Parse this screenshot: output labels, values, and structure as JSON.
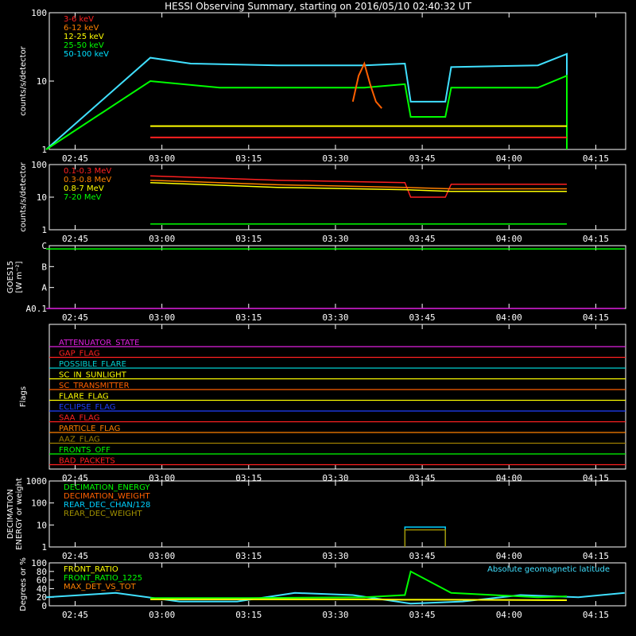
{
  "title": "HESSI Observing Summary, starting on 2016/05/10 02:40:32 UT",
  "time_labels": [
    "02:45",
    "03:00",
    "03:15",
    "03:30",
    "03:45",
    "04:00",
    "04:15"
  ],
  "chart_data": [
    {
      "type": "line",
      "name": "panel-1",
      "ylabel": "counts/s/detector",
      "yscale": "log",
      "ylim": [
        1,
        100
      ],
      "yticks": [
        "1",
        "10",
        "100"
      ],
      "legend": [
        {
          "label": "3-6 keV",
          "color": "#ff2020"
        },
        {
          "label": "6-12 keV",
          "color": "#ff8000"
        },
        {
          "label": "12-25 keV",
          "color": "#ffff00"
        },
        {
          "label": "25-50 keV",
          "color": "#00ff00"
        },
        {
          "label": "50-100 keV",
          "color": "#00e0ff"
        }
      ],
      "series": [
        {
          "name": "50-100 keV",
          "color": "#40e0ff",
          "x": [
            "02:40",
            "02:58",
            "03:05",
            "03:20",
            "03:35",
            "03:42",
            "03:43",
            "03:49",
            "03:50",
            "04:05",
            "04:10",
            "04:10"
          ],
          "y": [
            1,
            22,
            18,
            17,
            17,
            18,
            5,
            5,
            16,
            17,
            25,
            1
          ]
        },
        {
          "name": "25-50 keV",
          "color": "#00ff00",
          "x": [
            "02:40",
            "02:58",
            "03:10",
            "03:25",
            "03:35",
            "03:42",
            "03:43",
            "03:49",
            "03:50",
            "04:05",
            "04:10",
            "04:10"
          ],
          "y": [
            1,
            10,
            8,
            8,
            8,
            9,
            3,
            3,
            8,
            8,
            12,
            1
          ]
        },
        {
          "name": "6-12 keV",
          "color": "#ff6000",
          "x": [
            "03:33",
            "03:34",
            "03:35",
            "03:36",
            "03:37",
            "03:38"
          ],
          "y": [
            5,
            12,
            18,
            9,
            5,
            4
          ]
        },
        {
          "name": "12-25 keV",
          "color": "#ffff00",
          "x": [
            "02:58",
            "03:20",
            "03:42",
            "03:50",
            "04:10"
          ],
          "y": [
            2.2,
            2.2,
            2.2,
            2.2,
            2.2
          ]
        },
        {
          "name": "3-6 keV",
          "color": "#ff2020",
          "x": [
            "02:58",
            "03:20",
            "03:42",
            "03:50",
            "04:10"
          ],
          "y": [
            1.5,
            1.5,
            1.5,
            1.5,
            1.5
          ]
        }
      ]
    },
    {
      "type": "line",
      "name": "panel-2",
      "ylabel": "counts/s/detector",
      "yscale": "log",
      "ylim": [
        1,
        100
      ],
      "yticks": [
        "1",
        "10",
        "100"
      ],
      "legend": [
        {
          "label": "0.1-0.3 MeV",
          "color": "#ff2020"
        },
        {
          "label": "0.3-0.8 MeV",
          "color": "#ff8000"
        },
        {
          "label": "0.8-7 MeV",
          "color": "#ffff00"
        },
        {
          "label": "7-20 MeV",
          "color": "#00ff00"
        }
      ],
      "series": [
        {
          "name": "0.1-0.3 MeV",
          "color": "#ff2020",
          "x": [
            "02:58",
            "03:20",
            "03:42",
            "03:43",
            "03:49",
            "03:50",
            "04:10"
          ],
          "y": [
            45,
            33,
            28,
            10,
            10,
            25,
            25
          ]
        },
        {
          "name": "0.3-0.8 MeV",
          "color": "#ff8000",
          "x": [
            "02:58",
            "03:20",
            "03:42",
            "03:50",
            "04:10"
          ],
          "y": [
            33,
            24,
            20,
            18,
            18
          ]
        },
        {
          "name": "0.8-7 MeV",
          "color": "#ffff00",
          "x": [
            "02:58",
            "03:20",
            "03:42",
            "03:50",
            "04:10"
          ],
          "y": [
            28,
            20,
            17,
            15,
            15
          ]
        },
        {
          "name": "7-20 MeV",
          "color": "#00ff00",
          "x": [
            "02:58",
            "03:20",
            "03:42",
            "03:50",
            "04:10"
          ],
          "y": [
            1.5,
            1.5,
            1.5,
            1.5,
            1.5
          ]
        }
      ]
    },
    {
      "type": "line",
      "name": "panel-3",
      "ylabel_lines": [
        "GOES15",
        "[W m⁻²]"
      ],
      "ylim": [
        "A0.1",
        "C"
      ],
      "yticks": [
        "A0.1",
        "A",
        "B",
        "C"
      ],
      "series": [
        {
          "name": "goes",
          "color": "#00ff00",
          "x": [
            "02:40",
            "03:30",
            "04:20"
          ],
          "y": [
            "B7",
            "B7",
            "B7"
          ]
        },
        {
          "name": "baseline",
          "color": "#e020e0",
          "x": [
            "02:40",
            "04:20"
          ],
          "y": [
            "A0.1",
            "A0.1"
          ]
        }
      ]
    },
    {
      "type": "line",
      "name": "panel-4",
      "ylabel": "Flags",
      "flags": [
        {
          "label": "ATTENUATOR_STATE",
          "color": "#e020e0"
        },
        {
          "label": "GAP_FLAG",
          "color": "#ff2020"
        },
        {
          "label": "POSSIBLE_FLARE",
          "color": "#00d0d0"
        },
        {
          "label": "SC_IN_SUNLIGHT",
          "color": "#ffff00"
        },
        {
          "label": "SC_TRANSMITTER",
          "color": "#ff6000"
        },
        {
          "label": "FLARE_FLAG",
          "color": "#ffff00"
        },
        {
          "label": "ECLIPSE_FLAG",
          "color": "#2040ff"
        },
        {
          "label": "SAA_FLAG",
          "color": "#ff2020"
        },
        {
          "label": "PARTICLE_FLAG",
          "color": "#ff8000"
        },
        {
          "label": "AAZ_FLAG",
          "color": "#a08000"
        },
        {
          "label": "FRONTS_OFF",
          "color": "#00ff00"
        },
        {
          "label": "BAD_PACKETS",
          "color": "#ff2020"
        }
      ]
    },
    {
      "type": "line",
      "name": "panel-5",
      "ylabel_lines": [
        "DECIMATION",
        "ENERGY or weight"
      ],
      "yscale": "log",
      "ylim": [
        1,
        1000
      ],
      "yticks": [
        "1",
        "10",
        "100",
        "1000"
      ],
      "legend": [
        {
          "label": "DECIMATION_ENERGY",
          "color": "#00ff00"
        },
        {
          "label": "DECIMATION_WEIGHT",
          "color": "#ff6000"
        },
        {
          "label": "REAR_DEC_CHAN/128",
          "color": "#00d0ff"
        },
        {
          "label": "REAR_DEC_WEIGHT",
          "color": "#a09000"
        }
      ],
      "series": [
        {
          "name": "REAR_DEC_CHAN/128",
          "color": "#00d0ff",
          "x": [
            "03:42",
            "03:42",
            "03:49",
            "03:49"
          ],
          "y": [
            1,
            8,
            8,
            1
          ]
        },
        {
          "name": "REAR_DEC_WEIGHT",
          "color": "#a09000",
          "x": [
            "03:42",
            "03:42",
            "03:49",
            "03:49"
          ],
          "y": [
            1,
            6,
            6,
            1
          ]
        }
      ]
    },
    {
      "type": "line",
      "name": "panel-6",
      "ylabel": "Degrees or %",
      "ylim": [
        0,
        100
      ],
      "yticks": [
        "0",
        "20",
        "40",
        "60",
        "80",
        "100"
      ],
      "legend": [
        {
          "label": "FRONT_RATIO",
          "color": "#ffff00"
        },
        {
          "label": "FRONT_RATIO_1225",
          "color": "#00ff00"
        },
        {
          "label": "MAX_DET_VS_TOT",
          "color": "#ff8000"
        }
      ],
      "legend_right": {
        "label": "Absolute geomagnetic latitude",
        "color": "#40e0ff"
      },
      "series": [
        {
          "name": "Absolute geomagnetic latitude",
          "color": "#40e0ff",
          "x": [
            "02:40",
            "02:52",
            "03:03",
            "03:13",
            "03:23",
            "03:33",
            "03:43",
            "03:52",
            "04:02",
            "04:12",
            "04:20"
          ],
          "y": [
            20,
            30,
            10,
            10,
            30,
            25,
            5,
            10,
            25,
            20,
            30
          ]
        },
        {
          "name": "FRONT_RATIO_1225",
          "color": "#00ff00",
          "x": [
            "02:58",
            "03:15",
            "03:35",
            "03:42",
            "03:43",
            "03:50",
            "04:05",
            "04:10"
          ],
          "y": [
            18,
            18,
            20,
            25,
            80,
            30,
            20,
            22
          ]
        },
        {
          "name": "FRONT_RATIO",
          "color": "#ffff00",
          "x": [
            "02:58",
            "03:15",
            "03:35",
            "03:42",
            "03:50",
            "04:10"
          ],
          "y": [
            15,
            15,
            15,
            14,
            14,
            13
          ]
        }
      ]
    }
  ]
}
